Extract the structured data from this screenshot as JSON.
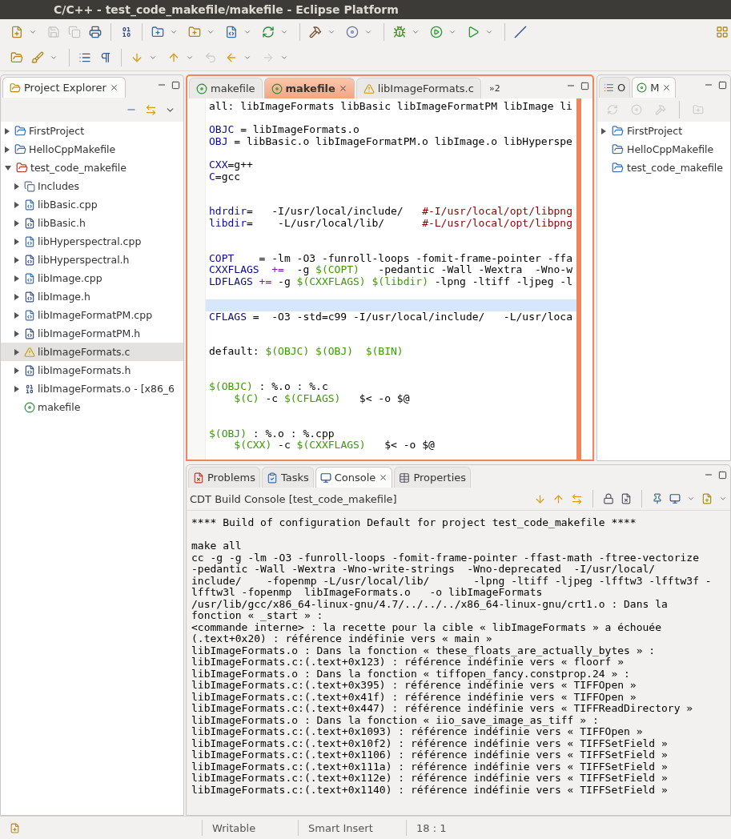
{
  "window": {
    "title": "C/C++ - test_code_makefile/makefile - Eclipse Platform"
  },
  "project_explorer": {
    "tab": {
      "label": "Project Explorer",
      "selected": true
    },
    "items": [
      {
        "label": "FirstProject",
        "kind": "project",
        "expanded": false,
        "selected": false
      },
      {
        "label": "HelloCppMakefile",
        "kind": "project",
        "expanded": false,
        "selected": false
      },
      {
        "label": "test_code_makefile",
        "kind": "project-error",
        "expanded": true,
        "selected": false,
        "children": [
          {
            "label": "Includes",
            "kind": "includes",
            "expanded": false,
            "selected": false
          },
          {
            "label": "libBasic.cpp",
            "kind": "source",
            "expanded": false,
            "selected": false
          },
          {
            "label": "libBasic.h",
            "kind": "header",
            "expanded": false,
            "selected": false
          },
          {
            "label": "libHyperspectral.cpp",
            "kind": "source",
            "expanded": false,
            "selected": false
          },
          {
            "label": "libHyperspectral.h",
            "kind": "header",
            "expanded": false,
            "selected": false
          },
          {
            "label": "libImage.cpp",
            "kind": "source",
            "expanded": false,
            "selected": false
          },
          {
            "label": "libImage.h",
            "kind": "header",
            "expanded": false,
            "selected": false
          },
          {
            "label": "libImageFormatPM.cpp",
            "kind": "source",
            "expanded": false,
            "selected": false
          },
          {
            "label": "libImageFormatPM.h",
            "kind": "header",
            "expanded": false,
            "selected": false
          },
          {
            "label": "libImageFormats.c",
            "kind": "source-warning",
            "expanded": false,
            "selected": true
          },
          {
            "label": "libImageFormats.h",
            "kind": "header",
            "expanded": false,
            "selected": false
          },
          {
            "label": "libImageFormats.o - [x86_6",
            "kind": "binary",
            "expanded": false,
            "selected": false
          },
          {
            "label": "makefile",
            "kind": "makefile",
            "selected": false
          }
        ]
      }
    ]
  },
  "editor": {
    "tabs": [
      {
        "label": "makefile",
        "kind": "makefile",
        "selected": false
      },
      {
        "label": "makefile",
        "kind": "makefile",
        "selected": true
      },
      {
        "label": "libImageFormats.c",
        "kind": "source-warning",
        "selected": false
      }
    ],
    "overflow": "»2",
    "lines": [
      {
        "current": false,
        "parts": [
          {
            "kind": "plain",
            "text": "all: libImageFormats libBasic libImageFormatPM libImage li"
          }
        ]
      },
      {
        "current": false
      },
      {
        "current": false,
        "parts": [
          {
            "kind": "variable",
            "text": "OBJC"
          },
          {
            "kind": "plain",
            "text": " = libImageFormats.o"
          }
        ]
      },
      {
        "current": false,
        "parts": [
          {
            "kind": "variable",
            "text": "OBJ"
          },
          {
            "kind": "plain",
            "text": " = libBasic.o libImageFormatPM.o libImage.o libHyperspe"
          }
        ]
      },
      {
        "current": false
      },
      {
        "current": false,
        "parts": [
          {
            "kind": "variable",
            "text": "CXX"
          },
          {
            "kind": "plain",
            "text": "=g++"
          }
        ]
      },
      {
        "current": false,
        "parts": [
          {
            "kind": "variable",
            "text": "C"
          },
          {
            "kind": "plain",
            "text": "=gcc"
          }
        ]
      },
      {
        "current": false
      },
      {
        "current": false
      },
      {
        "current": false,
        "parts": [
          {
            "kind": "variable",
            "text": "hdrdir"
          },
          {
            "kind": "plain",
            "text": "=   -I/usr/local/include/   "
          },
          {
            "kind": "comment",
            "text": "#-I/usr/local/opt/libpng"
          }
        ]
      },
      {
        "current": false,
        "parts": [
          {
            "kind": "variable",
            "text": "libdir"
          },
          {
            "kind": "plain",
            "text": "=    -L/usr/local/lib/      "
          },
          {
            "kind": "comment",
            "text": "#-L/usr/local/opt/libpng"
          }
        ]
      },
      {
        "current": false
      },
      {
        "current": false
      },
      {
        "current": false,
        "parts": [
          {
            "kind": "variable",
            "text": "COPT"
          },
          {
            "kind": "plain",
            "text": "    = -lm -O3 -funroll-loops -fomit-frame-pointer -ffa"
          }
        ]
      },
      {
        "current": false,
        "parts": [
          {
            "kind": "variable",
            "text": "CXXFLAGS"
          },
          {
            "kind": "operator",
            "text": "  +="
          },
          {
            "kind": "plain",
            "text": "  -g "
          },
          {
            "kind": "reference",
            "text": "$(COPT)"
          },
          {
            "kind": "plain",
            "text": "   -pedantic -Wall -Wextra  -Wno-w"
          }
        ]
      },
      {
        "current": false,
        "parts": [
          {
            "kind": "variable",
            "text": "LDFLAGS"
          },
          {
            "kind": "operator",
            "text": " +="
          },
          {
            "kind": "plain",
            "text": " -g "
          },
          {
            "kind": "reference",
            "text": "$(CXXFLAGS) "
          },
          {
            "kind": "reference",
            "text": "$(libdir)"
          },
          {
            "kind": "plain",
            "text": " -lpng -ltiff -ljpeg -l"
          }
        ]
      },
      {
        "current": false
      },
      {
        "current": true
      },
      {
        "current": false,
        "parts": [
          {
            "kind": "variable",
            "text": "CFLAGS"
          },
          {
            "kind": "plain",
            "text": " =  -O3 -std=c99 -I/usr/local/include/   -L/usr/loca"
          }
        ]
      },
      {
        "current": false
      },
      {
        "current": false
      },
      {
        "current": false,
        "parts": [
          {
            "kind": "plain",
            "text": "default: "
          },
          {
            "kind": "reference",
            "text": "$(OBJC) "
          },
          {
            "kind": "reference",
            "text": "$(OBJ)  "
          },
          {
            "kind": "reference",
            "text": "$(BIN)"
          }
        ]
      },
      {
        "current": false
      },
      {
        "current": false
      },
      {
        "current": false,
        "parts": [
          {
            "kind": "reference",
            "text": "$(OBJC)"
          },
          {
            "kind": "plain",
            "text": " : %.o : %.c"
          }
        ]
      },
      {
        "current": false,
        "parts": [
          {
            "kind": "reference",
            "text": "    $(C)"
          },
          {
            "kind": "plain",
            "text": " -c "
          },
          {
            "kind": "reference",
            "text": "$(CFLAGS)"
          },
          {
            "kind": "plain",
            "text": "   $< -o $@"
          }
        ]
      },
      {
        "current": false
      },
      {
        "current": false
      },
      {
        "current": false,
        "parts": [
          {
            "kind": "reference",
            "text": "$(OBJ)"
          },
          {
            "kind": "plain",
            "text": " : %.o : %.cpp"
          }
        ]
      },
      {
        "current": false,
        "parts": [
          {
            "kind": "reference",
            "text": "    $(CXX)"
          },
          {
            "kind": "plain",
            "text": " -c "
          },
          {
            "kind": "reference",
            "text": "$(CXXFLAGS)"
          },
          {
            "kind": "plain",
            "text": "   $< -o $@"
          }
        ]
      }
    ]
  },
  "side_view": {
    "tabs": [
      {
        "label": "O",
        "kind": "outline",
        "selected": false
      },
      {
        "label": "M",
        "kind": "make",
        "selected": true
      }
    ],
    "items": [
      {
        "label": "FirstProject",
        "expanded": false
      },
      {
        "label": "HelloCppMakefile"
      },
      {
        "label": "test_code_makefile"
      }
    ]
  },
  "console_view": {
    "tabs": [
      {
        "label": "Problems",
        "kind": "problems",
        "selected": false
      },
      {
        "label": "Tasks",
        "kind": "tasks",
        "selected": false
      },
      {
        "label": "Console",
        "kind": "console",
        "selected": true
      },
      {
        "label": "Properties",
        "kind": "properties",
        "selected": false
      }
    ],
    "title": "CDT Build Console [test_code_makefile]",
    "header": "**** Build of configuration Default for project test_code_makefile ****",
    "lines": [
      "make all",
      "cc -g -g -lm -O3 -funroll-loops -fomit-frame-pointer -ffast-math -ftree-vectorize",
      "-pedantic -Wall -Wextra -Wno-write-strings  -Wno-deprecated  -I/usr/local/",
      "include/    -fopenmp -L/usr/local/lib/       -lpng -ltiff -ljpeg -lfftw3 -lfftw3f -",
      "lfftw3l -fopenmp  libImageFormats.o   -o libImageFormats",
      "/usr/lib/gcc/x86_64-linux-gnu/4.7/../../../x86_64-linux-gnu/crt1.o : Dans la",
      "fonction « _start » :",
      "<commande interne> : la recette pour la cible « libImageFormats » a échouée",
      "(.text+0x20) : référence indéfinie vers « main »",
      "libImageFormats.o : Dans la fonction « these_floats_are_actually_bytes » :",
      "libImageFormats.c:(.text+0x123) : référence indéfinie vers « floorf »",
      "libImageFormats.o : Dans la fonction « tiffopen_fancy.constprop.24 » :",
      "libImageFormats.c:(.text+0x395) : référence indéfinie vers « TIFFOpen »",
      "libImageFormats.c:(.text+0x41f) : référence indéfinie vers « TIFFOpen »",
      "libImageFormats.c:(.text+0x447) : référence indéfinie vers « TIFFReadDirectory »",
      "libImageFormats.o : Dans la fonction « iio_save_image_as_tiff » :",
      "libImageFormats.c:(.text+0x1093) : référence indéfinie vers « TIFFOpen »",
      "libImageFormats.c:(.text+0x10f2) : référence indéfinie vers « TIFFSetField »",
      "libImageFormats.c:(.text+0x1106) : référence indéfinie vers « TIFFSetField »",
      "libImageFormats.c:(.text+0x111a) : référence indéfinie vers « TIFFSetField »",
      "libImageFormats.c:(.text+0x112e) : référence indéfinie vers « TIFFSetField »",
      "libImageFormats.c:(.text+0x1140) : référence indéfinie vers « TIFFSetField »"
    ]
  },
  "status_bar": {
    "fields": [
      "Writable",
      "Smart Insert",
      "18 : 1"
    ]
  }
}
